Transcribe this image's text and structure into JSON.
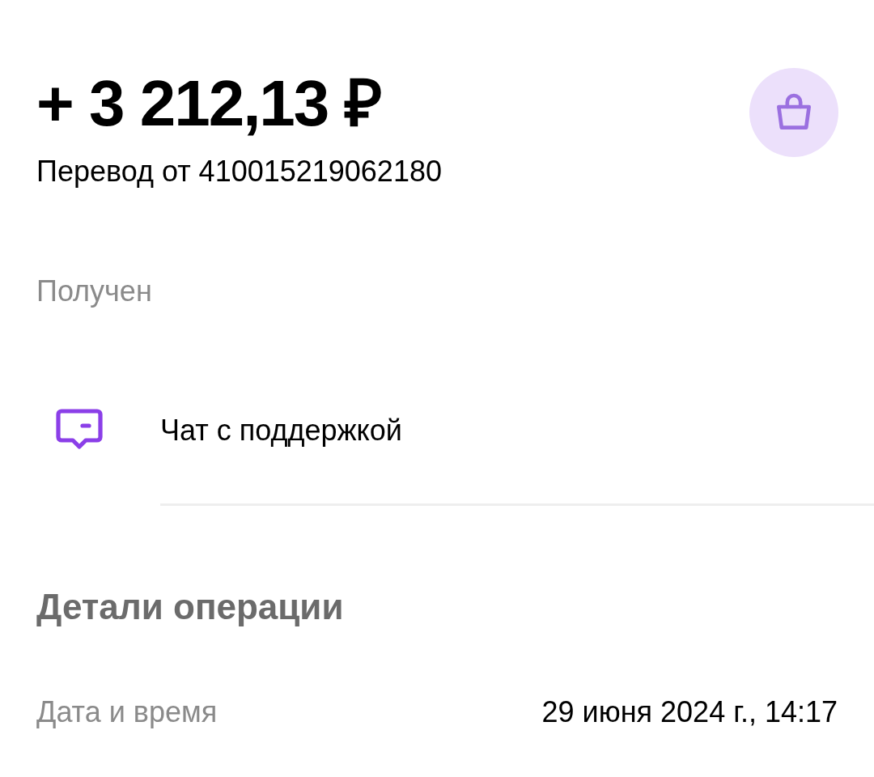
{
  "amount": "+ 3 212,13 ₽",
  "subtitle": "Перевод от 410015219062180",
  "status": "Получен",
  "support": {
    "label": "Чат с поддержкой"
  },
  "details": {
    "title": "Детали операции",
    "rows": [
      {
        "label": "Дата и время",
        "value": "29 июня 2024 г., 14:17"
      }
    ]
  }
}
